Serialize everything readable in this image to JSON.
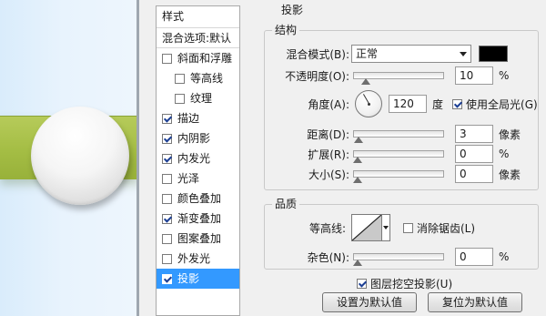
{
  "styles_panel": {
    "header": "样式",
    "blend_options_label": "混合选项:默认",
    "items": [
      {
        "label": "斜面和浮雕",
        "checked": false,
        "indent": false,
        "selected": false
      },
      {
        "label": "等高线",
        "checked": false,
        "indent": true,
        "selected": false
      },
      {
        "label": "纹理",
        "checked": false,
        "indent": true,
        "selected": false
      },
      {
        "label": "描边",
        "checked": true,
        "indent": false,
        "selected": false
      },
      {
        "label": "内阴影",
        "checked": true,
        "indent": false,
        "selected": false
      },
      {
        "label": "内发光",
        "checked": true,
        "indent": false,
        "selected": false
      },
      {
        "label": "光泽",
        "checked": false,
        "indent": false,
        "selected": false
      },
      {
        "label": "颜色叠加",
        "checked": false,
        "indent": false,
        "selected": false
      },
      {
        "label": "渐变叠加",
        "checked": true,
        "indent": false,
        "selected": false
      },
      {
        "label": "图案叠加",
        "checked": false,
        "indent": false,
        "selected": false
      },
      {
        "label": "外发光",
        "checked": false,
        "indent": false,
        "selected": false
      },
      {
        "label": "投影",
        "checked": true,
        "indent": false,
        "selected": true
      }
    ]
  },
  "drop_shadow": {
    "title": "投影",
    "structure": {
      "title": "结构",
      "blend_mode_label": "混合模式(B):",
      "blend_mode_value": "正常",
      "shadow_color": "#000000",
      "opacity_label": "不透明度(O):",
      "opacity_value": "10",
      "opacity_fraction": 0.1,
      "opacity_unit": "%",
      "angle_label": "角度(A):",
      "angle_value": "120",
      "angle_unit": "度",
      "global_light_label": "使用全局光(G)",
      "global_light_checked": true,
      "distance_label": "距离(D):",
      "distance_value": "3",
      "distance_fraction": 0.01,
      "distance_unit": "像素",
      "spread_label": "扩展(R):",
      "spread_value": "0",
      "spread_fraction": 0,
      "spread_unit": "%",
      "size_label": "大小(S):",
      "size_value": "0",
      "size_fraction": 0,
      "size_unit": "像素"
    },
    "quality": {
      "title": "品质",
      "contour_label": "等高线:",
      "anti_alias_label": "消除锯齿(L)",
      "anti_alias_checked": false,
      "noise_label": "杂色(N):",
      "noise_value": "0",
      "noise_fraction": 0,
      "noise_unit": "%"
    },
    "knockout_label": "图层挖空投影(U)",
    "knockout_checked": true,
    "make_default_label": "设置为默认值",
    "reset_default_label": "复位为默认值"
  },
  "colors": {
    "selection": "#3399ff",
    "canvas_bar": "#a4bd44"
  }
}
